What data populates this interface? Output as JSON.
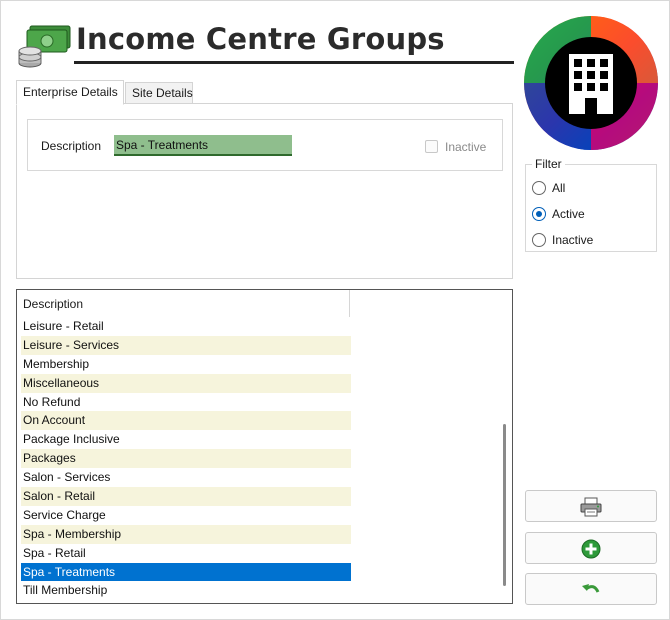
{
  "header": {
    "title": "Income Centre Groups",
    "icon": "money-coins-icon",
    "logo": "building-logo-icon"
  },
  "tabs": [
    {
      "label": "Enterprise Details",
      "active": true
    },
    {
      "label": "Site Details",
      "active": false
    }
  ],
  "details": {
    "description_label": "Description",
    "description_value": "Spa - Treatments",
    "inactive_label": "Inactive",
    "inactive_checked": false
  },
  "filter": {
    "legend": "Filter",
    "options": [
      {
        "label": "All",
        "checked": false
      },
      {
        "label": "Active",
        "checked": true
      },
      {
        "label": "Inactive",
        "checked": false
      }
    ]
  },
  "list": {
    "header": "Description",
    "rows": [
      "Leisure -  Retail",
      "Leisure - Services",
      "Membership",
      "Miscellaneous",
      "No Refund",
      "On Account",
      "Package Inclusive",
      "Packages",
      "Salon -  Services",
      "Salon - Retail",
      "Service Charge",
      "Spa -   Membership",
      "Spa - Retail",
      "Spa - Treatments",
      "Till Membership"
    ],
    "selected_index": 13
  },
  "actions": [
    {
      "name": "print-button",
      "icon": "printer-icon"
    },
    {
      "name": "add-button",
      "icon": "plus-circle-icon"
    },
    {
      "name": "undo-button",
      "icon": "undo-arrow-icon"
    }
  ],
  "colors": {
    "accent": "#0072d0",
    "input_highlight": "#8fbe8d",
    "alt_row": "#f6f4dc",
    "add_green": "#2e9a3a"
  }
}
